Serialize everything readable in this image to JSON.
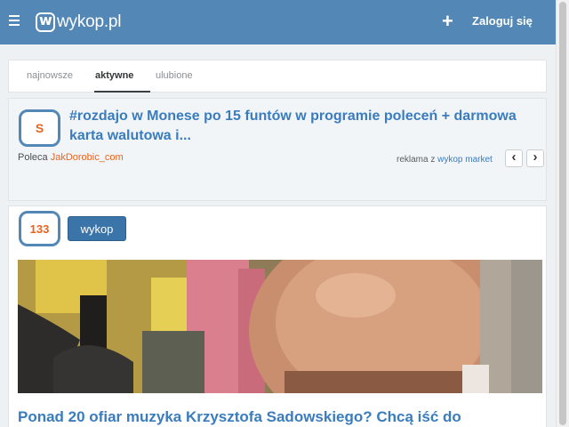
{
  "header": {
    "menu_icon": "hamburger-icon",
    "logo_text": "wykop.pl",
    "add_icon": "plus-icon",
    "add_label": "+",
    "login_label": "Zaloguj się",
    "colors": {
      "bar": "#5388b6"
    }
  },
  "tabs": [
    {
      "label": "najnowsze",
      "active": false
    },
    {
      "label": "aktywne",
      "active": true
    },
    {
      "label": "ulubione",
      "active": false
    }
  ],
  "ad": {
    "badge": "S",
    "title": "#rozdajo w Monese po 15 funtów w programie poleceń + darmowa karta walutowa i...",
    "recommend_prefix": "Poleca ",
    "recommend_author": "JakDorobic_com",
    "market_prefix": "reklama z ",
    "market_link": "wykop market",
    "prev_icon": "chevron-left-icon",
    "next_icon": "chevron-right-icon",
    "prev_label": "‹",
    "next_label": "›"
  },
  "link": {
    "votes": "133",
    "wykop_label": "wykop",
    "title": "Ponad 20 ofiar muzyka Krzysztofa Sadowskiego? Chcą iść do"
  }
}
